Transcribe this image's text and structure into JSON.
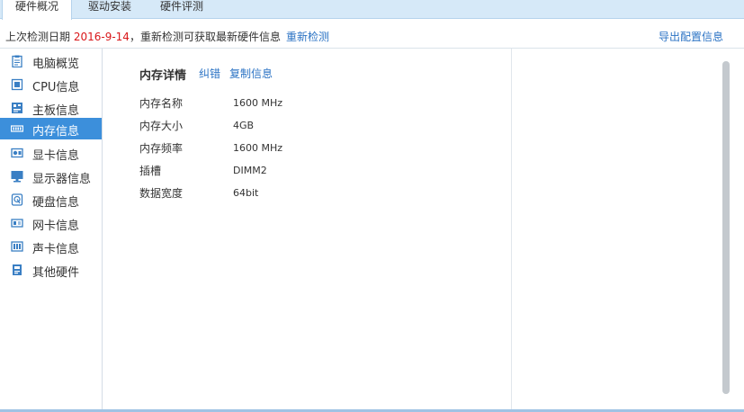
{
  "tabs": [
    {
      "label": "硬件概况",
      "active": true
    },
    {
      "label": "驱动安装",
      "active": false
    },
    {
      "label": "硬件评测",
      "active": false
    }
  ],
  "infobar": {
    "prefix": "上次检测日期 ",
    "date": "2016-9-14",
    "suffix": "，重新检测可获取最新硬件信息",
    "recheck_label": "重新检测",
    "export_label": "导出配置信息"
  },
  "sidebar": {
    "active_index": 3,
    "items": [
      {
        "label": "电脑概览",
        "icon": "clipboard-icon"
      },
      {
        "label": "CPU信息",
        "icon": "cpu-icon"
      },
      {
        "label": "主板信息",
        "icon": "motherboard-icon"
      },
      {
        "label": "内存信息",
        "icon": "memory-icon"
      },
      {
        "label": "显卡信息",
        "icon": "graphics-card-icon"
      },
      {
        "label": "显示器信息",
        "icon": "monitor-icon"
      },
      {
        "label": "硬盘信息",
        "icon": "hard-disk-icon"
      },
      {
        "label": "网卡信息",
        "icon": "network-card-icon"
      },
      {
        "label": "声卡信息",
        "icon": "sound-card-icon"
      },
      {
        "label": "其他硬件",
        "icon": "other-hardware-icon"
      }
    ]
  },
  "detail": {
    "title": "内存详情",
    "fix_label": "纠错",
    "copy_label": "复制信息",
    "rows": [
      {
        "label": "内存名称",
        "value": "1600 MHz"
      },
      {
        "label": "内存大小",
        "value": "4GB"
      },
      {
        "label": "内存频率",
        "value": "1600 MHz"
      },
      {
        "label": "插槽",
        "value": "DIMM2"
      },
      {
        "label": "数据宽度",
        "value": "64bit"
      }
    ]
  },
  "colors": {
    "accent": "#3c8fdb",
    "link": "#2b73c4",
    "date": "#d9171a",
    "icon": "#3a7fc4"
  }
}
